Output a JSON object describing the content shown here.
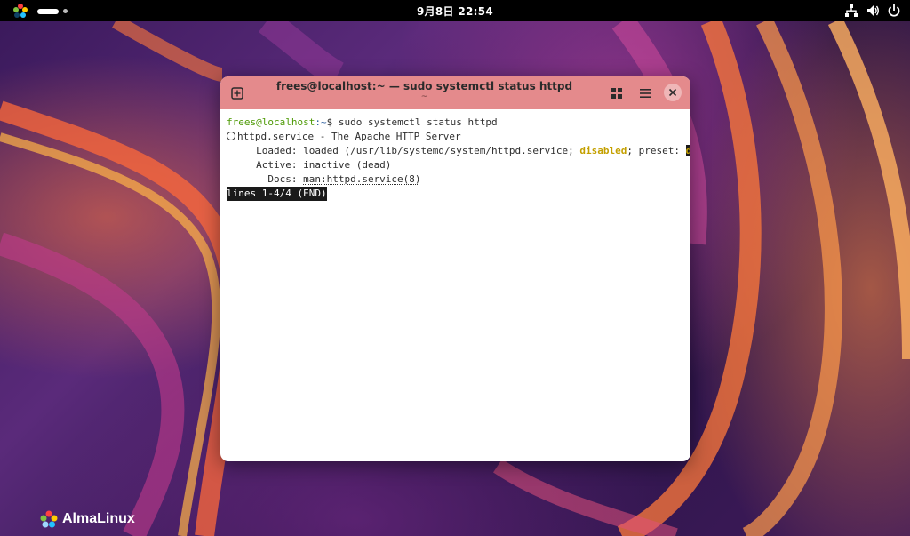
{
  "topbar": {
    "clock": "9月8日  22:54",
    "icons": [
      "network-icon",
      "volume-icon",
      "power-icon"
    ]
  },
  "window": {
    "title": "frees@localhost:~ — sudo systemctl status httpd",
    "subtitle": "~",
    "buttons": [
      "new-tab-button",
      "tab-overview-button",
      "menu-button",
      "close-button"
    ]
  },
  "terminal": {
    "prompt_user": "frees@localhost",
    "prompt_path": ":~",
    "prompt_sym": "$",
    "command": " sudo systemctl status httpd",
    "service_line": "httpd.service - The Apache HTTP Server",
    "loaded_label": "     Loaded: loaded (",
    "loaded_path": "/usr/lib/systemd/system/httpd.service",
    "loaded_sep": "; ",
    "loaded_state": "disabled",
    "loaded_preset": "; preset: ",
    "loaded_trunc": "d>",
    "active_line": "     Active: inactive (dead)",
    "docs_label": "       Docs: ",
    "docs_value": "man:httpd.service(8)",
    "pager_status": "lines 1-4/4 (END)"
  },
  "brand": {
    "name": "AlmaLinux"
  },
  "colors": {
    "titlebar": "#e48a8c",
    "prompt_green": "#4e9a06",
    "prompt_blue": "#3465a4",
    "warning_yellow": "#c4a000"
  }
}
